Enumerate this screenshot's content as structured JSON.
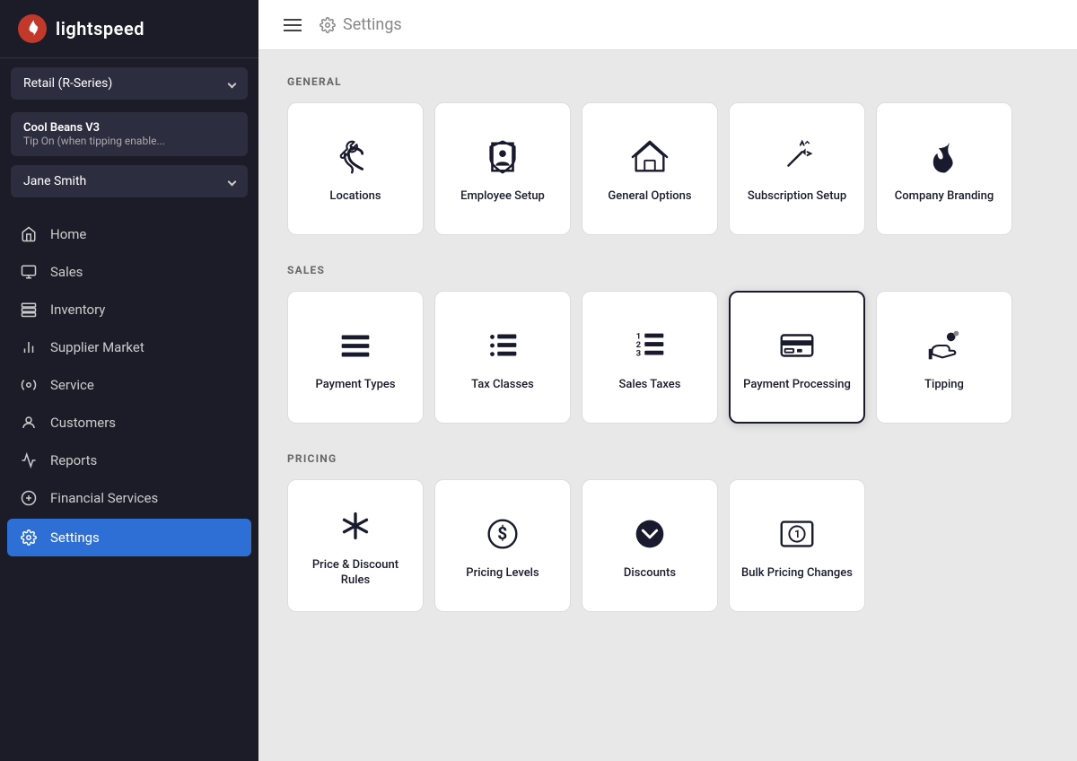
{
  "sidebar": {
    "logo_text": "lightspeed",
    "store_selector": {
      "label": "Retail (R-Series)"
    },
    "store_info": {
      "name": "Cool Beans V3",
      "tip": "Tip On (when tipping enable..."
    },
    "user_selector": {
      "label": "Jane Smith"
    },
    "nav_items": [
      {
        "id": "home",
        "label": "Home",
        "icon": "home"
      },
      {
        "id": "sales",
        "label": "Sales",
        "icon": "sales"
      },
      {
        "id": "inventory",
        "label": "Inventory",
        "icon": "inventory"
      },
      {
        "id": "supplier-market",
        "label": "Supplier Market",
        "icon": "supplier"
      },
      {
        "id": "service",
        "label": "Service",
        "icon": "service"
      },
      {
        "id": "customers",
        "label": "Customers",
        "icon": "customers"
      },
      {
        "id": "reports",
        "label": "Reports",
        "icon": "reports"
      },
      {
        "id": "financial-services",
        "label": "Financial Services",
        "icon": "financial"
      },
      {
        "id": "settings",
        "label": "Settings",
        "icon": "settings",
        "active": true
      }
    ]
  },
  "topbar": {
    "title": "Settings",
    "gear_icon": "⚙"
  },
  "sections": {
    "general": {
      "label": "GENERAL",
      "cards": [
        {
          "id": "locations",
          "label": "Locations",
          "icon": "wrench"
        },
        {
          "id": "employee-setup",
          "label": "Employee Setup",
          "icon": "shield"
        },
        {
          "id": "general-options",
          "label": "General Options",
          "icon": "house"
        },
        {
          "id": "subscription-setup",
          "label": "Subscription Setup",
          "icon": "sparkle-pen"
        },
        {
          "id": "company-branding",
          "label": "Company Branding",
          "icon": "flame"
        }
      ]
    },
    "sales": {
      "label": "SALES",
      "cards": [
        {
          "id": "payment-types",
          "label": "Payment Types",
          "icon": "list"
        },
        {
          "id": "tax-classes",
          "label": "Tax Classes",
          "icon": "list2"
        },
        {
          "id": "sales-taxes",
          "label": "Sales Taxes",
          "icon": "numbered-list"
        },
        {
          "id": "payment-processing",
          "label": "Payment Processing",
          "icon": "credit-card",
          "selected": true
        },
        {
          "id": "tipping",
          "label": "Tipping",
          "icon": "tipping"
        }
      ]
    },
    "pricing": {
      "label": "PRICING",
      "cards": [
        {
          "id": "price-discount-rules",
          "label": "Price & Discount Rules",
          "icon": "asterisk"
        },
        {
          "id": "pricing-levels",
          "label": "Pricing Levels",
          "icon": "dollar"
        },
        {
          "id": "discounts",
          "label": "Discounts",
          "icon": "chevron-circle"
        },
        {
          "id": "bulk-pricing-changes",
          "label": "Bulk Pricing Changes",
          "icon": "cash"
        }
      ]
    }
  }
}
